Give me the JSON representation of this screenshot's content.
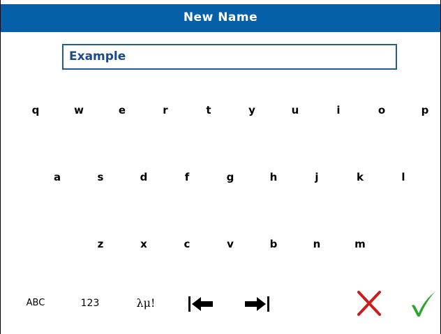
{
  "header": {
    "title": "New Name"
  },
  "name_field": {
    "value": "Example"
  },
  "keyboard": {
    "row1": [
      "q",
      "w",
      "e",
      "r",
      "t",
      "y",
      "u",
      "i",
      "o",
      "p"
    ],
    "row2": [
      "a",
      "s",
      "d",
      "f",
      "g",
      "h",
      "j",
      "k",
      "l"
    ],
    "row3": [
      "z",
      "x",
      "c",
      "v",
      "b",
      "n",
      "m"
    ]
  },
  "toolbar": {
    "abc_label": "ABC",
    "num_label": "123",
    "sym_label": "λμ!",
    "cursor_left_icon": "cursor-left-icon",
    "cursor_right_icon": "cursor-right-icon",
    "cancel_icon": "cancel-icon",
    "confirm_icon": "confirm-icon"
  },
  "colors": {
    "title_bar": "#0560a8",
    "field_border": "#1f5f8b",
    "field_text": "#1a4a8a",
    "cancel": "#cc1c1c",
    "confirm": "#2ea52e"
  }
}
